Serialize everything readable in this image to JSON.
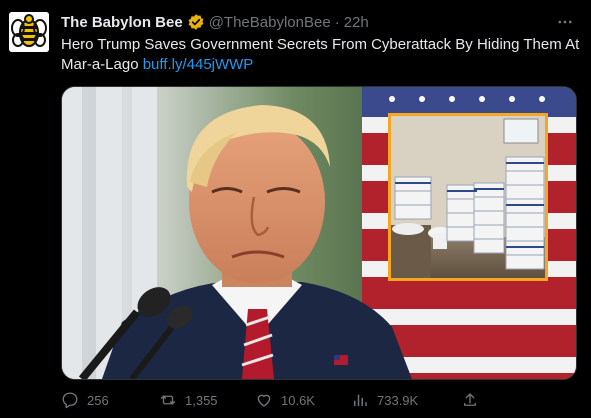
{
  "tweet": {
    "author": {
      "display_name": "The Babylon Bee",
      "handle": "@TheBabylonBee",
      "verified": true,
      "avatar_icon": "babylon-bee-logo",
      "badge_color": "#e8b308"
    },
    "separator": "·",
    "time": "22h",
    "text": "Hero Trump Saves Government Secrets From Cyberattack By Hiding Them At Mar-a-Lago",
    "link_text": "buff.ly/445jWWP",
    "link_color": "#1d9bf0",
    "media": {
      "main_image": "photo of Trump at a podium in front of an American flag",
      "inset_image": "photo of stacked document boxes in a bathroom",
      "inset_border_color": "#f5a623"
    },
    "menu_icon": "more-horizontal-icon",
    "actions": {
      "replies": "256",
      "retweets": "1,355",
      "likes": "10.6K",
      "views": "733.9K"
    }
  },
  "colors": {
    "background": "#000000",
    "text_primary": "#e7e9ea",
    "text_secondary": "#71767b"
  }
}
